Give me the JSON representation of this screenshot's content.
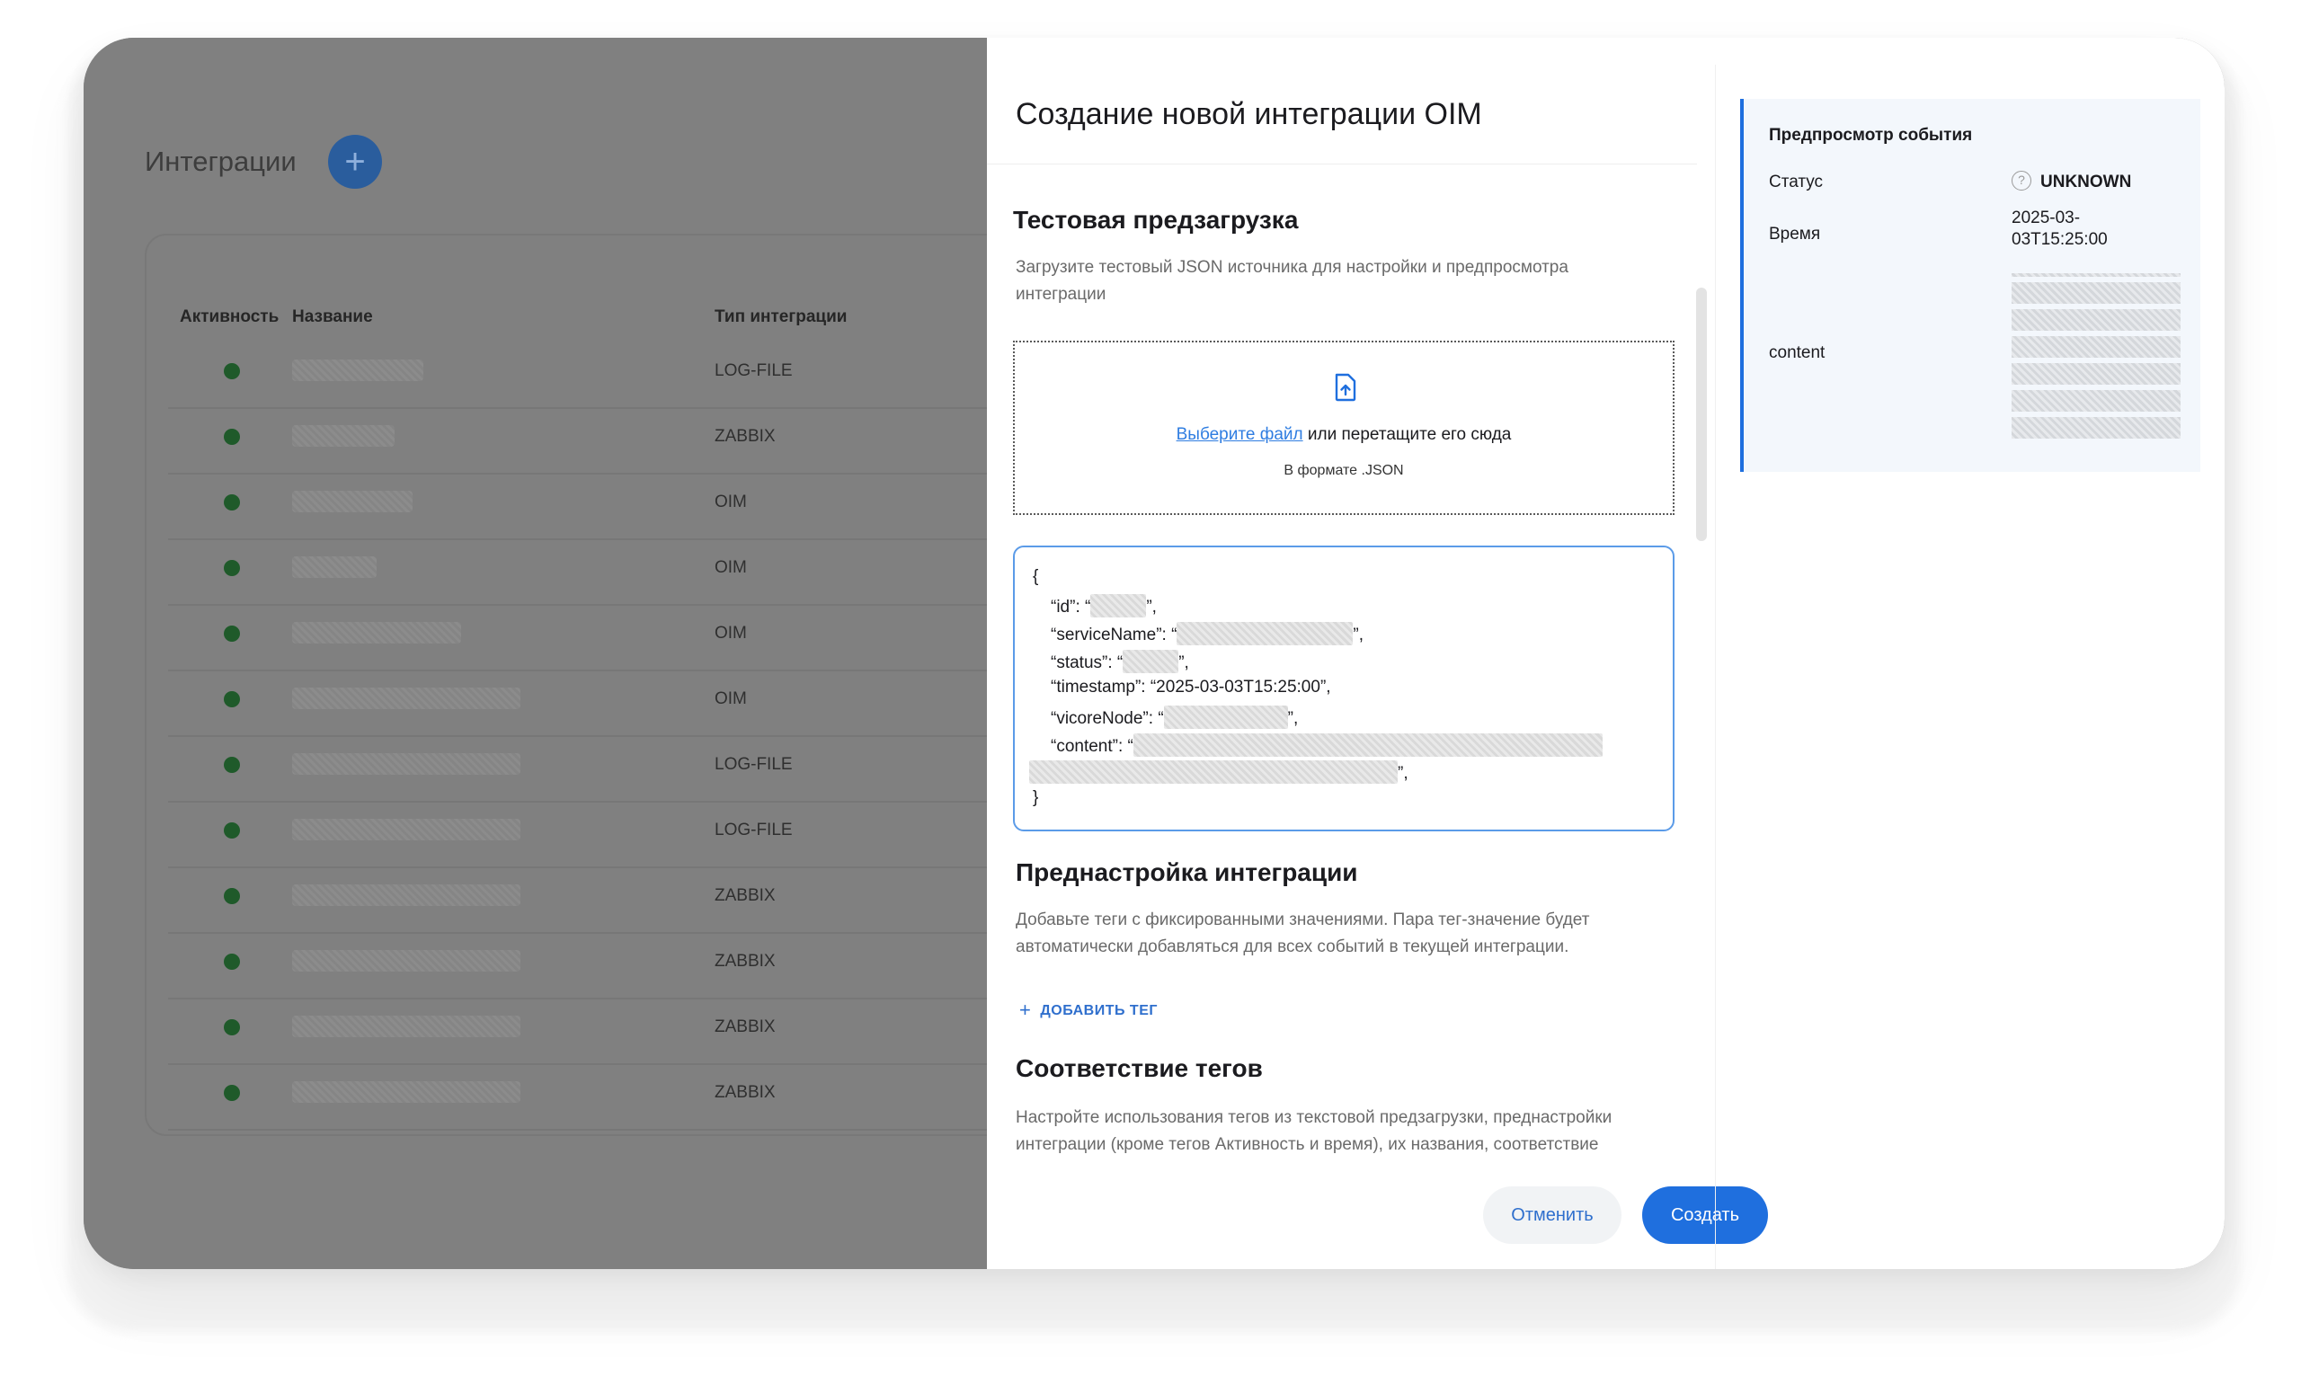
{
  "background": {
    "page_title": "Интеграции",
    "add_icon": "+",
    "table": {
      "columns": [
        "Активность",
        "Название",
        "Тип интеграции"
      ],
      "rows": [
        {
          "type": "LOG-FILE"
        },
        {
          "type": "ZABBIX"
        },
        {
          "type": "OIM"
        },
        {
          "type": "OIM"
        },
        {
          "type": "OIM"
        },
        {
          "type": "OIM"
        },
        {
          "type": "LOG-FILE"
        },
        {
          "type": "LOG-FILE"
        },
        {
          "type": "ZABBIX"
        },
        {
          "type": "ZABBIX"
        },
        {
          "type": "ZABBIX"
        },
        {
          "type": "ZABBIX"
        }
      ]
    }
  },
  "modal": {
    "title": "Создание новой интеграции OIM",
    "upload_section": {
      "title": "Тестовая предзагрузка",
      "description": "Загрузите тестовый JSON источника для настройки и предпросмотра интеграции",
      "choose_file_link": "Выберите файл",
      "drop_text": "или перетащите его сюда",
      "format_hint": "В формате .JSON",
      "upload_icon": "file-upload-icon"
    },
    "json_preview": {
      "open": "{",
      "close": "}",
      "fields": {
        "id": "“id”:",
        "serviceName": "“serviceName”:",
        "status": "“status”:",
        "timestamp": "“timestamp”:",
        "timestamp_value": "“2025-03-03T15:25:00”,",
        "vicoreNode": "“vicoreNode”:",
        "content": "“content”:"
      }
    },
    "presetup_section": {
      "title": "Преднастройка интеграции",
      "description": "Добавьте теги с фиксированными значениями. Пара тег-значение будет автоматически добавляться для всех событий в текущей интеграции.",
      "add_tag_label": "ДОБАВИТЬ ТЕГ"
    },
    "mapping_section": {
      "title": "Соответствие тегов",
      "description": "Настройте использования тегов из текстовой предзагрузки, преднастройки интеграции (кроме тегов Активность и время), их названия, соответствие системным тегам."
    },
    "buttons": {
      "cancel": "Отменить",
      "create": "Создать"
    }
  },
  "preview": {
    "title": "Предпросмотр события",
    "status_label": "Статус",
    "status_value": "UNKNOWN",
    "status_icon": "question-circle-icon",
    "time_label": "Время",
    "time_value_line1": "2025-03-",
    "time_value_line2": "03T15:25:00",
    "content_label": "content"
  },
  "colors": {
    "accent": "#1f6fde",
    "link": "#2f7de1",
    "overlay": "#808080",
    "active_dot": "#1f5a2a"
  }
}
